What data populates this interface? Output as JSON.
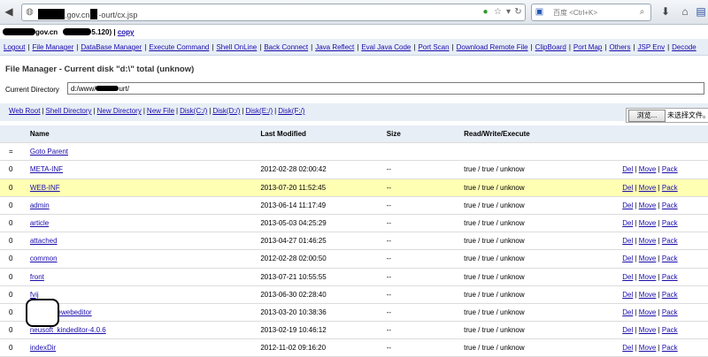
{
  "browser": {
    "url_domain": ".gov.cn",
    "url_path": "-ourt/cx.jsp",
    "search_placeholder": "百度 <Ctrl+K>"
  },
  "header": {
    "server_domain": "gov.cn",
    "server_suffix": "5.120) |",
    "copy_label": "copy"
  },
  "menu": [
    "Logout",
    "File Manager",
    "DataBase Manager",
    "Execute Command",
    "Shell OnLine",
    "Back Connect",
    "Java Reflect",
    "Eval Java Code",
    "Port Scan",
    "Download Remote File",
    "ClipBoard",
    "Port Map",
    "Others",
    "JSP Env",
    "Decode"
  ],
  "title": "File Manager - Current disk \"d:\\\" total (unknow)",
  "current_directory": {
    "label": "Current Directory",
    "value_prefix": "d:/www/",
    "value_suffix": "urt/"
  },
  "links": [
    "Web Root",
    "Shell Directory",
    "New Directory",
    "New File",
    "Disk(C:/)",
    "Disk(D:/)",
    "Disk(E:/)",
    "Disk(F:/)"
  ],
  "upload": {
    "browse_label": "浏览...",
    "no_file_label": "未选择文件。"
  },
  "table": {
    "columns": [
      "Name",
      "Last Modified",
      "Size",
      "Read/Write/Execute"
    ],
    "parent": {
      "marker": "=",
      "label": "Goto Parent"
    },
    "rows": [
      {
        "idx": "0",
        "name": "META-INF",
        "modified": "2012-02-28 02:00:42",
        "size": "--",
        "rwx": "true / true / unknow",
        "highlight": false
      },
      {
        "idx": "0",
        "name": "WEB-INF",
        "modified": "2013-07-20 11:52:45",
        "size": "--",
        "rwx": "true / true / unknow",
        "highlight": true
      },
      {
        "idx": "0",
        "name": "admin",
        "modified": "2013-06-14 11:17:49",
        "size": "--",
        "rwx": "true / true / unknow",
        "highlight": false
      },
      {
        "idx": "0",
        "name": "article",
        "modified": "2013-05-03 04:25:29",
        "size": "--",
        "rwx": "true / true / unknow",
        "highlight": false
      },
      {
        "idx": "0",
        "name": "attached",
        "modified": "2013-04-27 01:46:25",
        "size": "--",
        "rwx": "true / true / unknow",
        "highlight": false
      },
      {
        "idx": "0",
        "name": "common",
        "modified": "2012-02-28 02:00:50",
        "size": "--",
        "rwx": "true / true / unknow",
        "highlight": false
      },
      {
        "idx": "0",
        "name": "front",
        "modified": "2013-07-21 10:55:55",
        "size": "--",
        "rwx": "true / true / unknow",
        "highlight": false
      },
      {
        "idx": "0",
        "name": "fvij",
        "modified": "2013-06-30 02:28:40",
        "size": "--",
        "rwx": "true / true / unknow",
        "highlight": false
      },
      {
        "idx": "0",
        "name": "neusoft_ewebeditor",
        "modified": "2013-03-20 10:38:36",
        "size": "--",
        "rwx": "true / true / unknow",
        "highlight": false
      },
      {
        "idx": "0",
        "name": "neusoft_kindeditor-4.0.6",
        "modified": "2013-02-19 10:46:12",
        "size": "--",
        "rwx": "true / true / unknow",
        "highlight": false
      },
      {
        "idx": "0",
        "name": "indexDir",
        "modified": "2012-11-02 09:16:20",
        "size": "--",
        "rwx": "true / true / unknow",
        "highlight": false
      }
    ],
    "actions": [
      "Del",
      "Move",
      "Pack"
    ]
  }
}
